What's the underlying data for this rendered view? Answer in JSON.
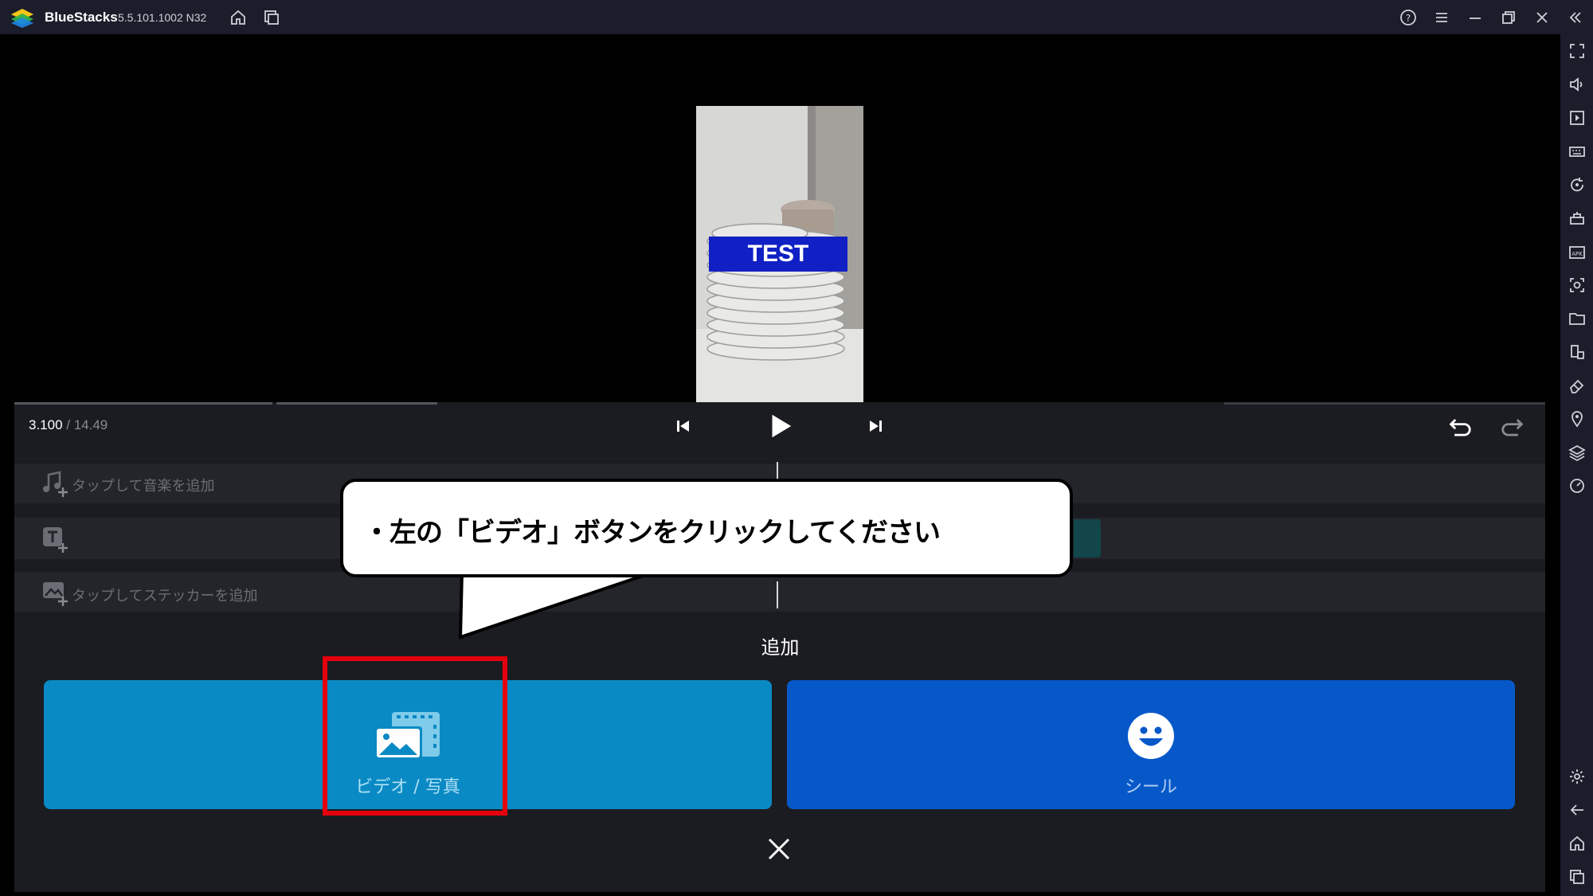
{
  "titlebar": {
    "app_name": "BlueStacks",
    "version": "5.5.101.1002  N32"
  },
  "player": {
    "preview_text": "TEST",
    "time_current": "3.100",
    "time_total": " / 14.49"
  },
  "tracks": {
    "music_label": "タップして音楽を追加",
    "sticker_label": "タップしてステッカーを追加"
  },
  "callout": {
    "text": "・左の「ビデオ」ボタンをクリックしてください"
  },
  "add_panel": {
    "title": "追加",
    "video_label": "ビデオ / 写真",
    "sticker_label": "シール"
  },
  "colors": {
    "video_button": "#0a8ac4",
    "sticker_button": "#0658c9",
    "highlight": "#e5000d"
  }
}
